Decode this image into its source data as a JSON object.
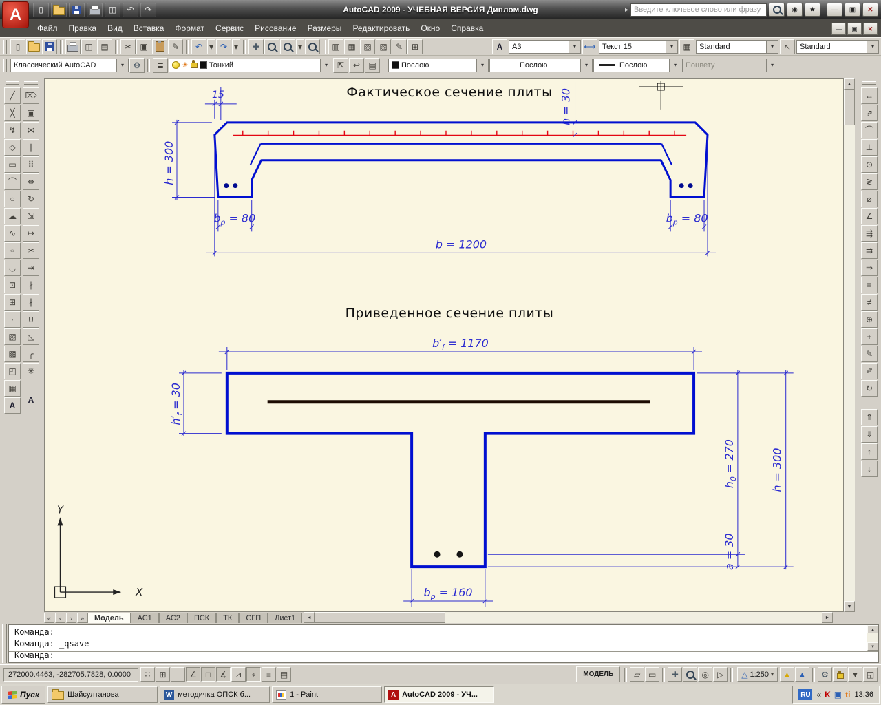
{
  "titlebar": {
    "logo_letter": "A",
    "title": "AutoCAD 2009 - УЧЕБНАЯ ВЕРСИЯ Диплом.dwg",
    "search_placeholder": "Введите ключевое слово или фразу",
    "quick_access": [
      {
        "name": "qnew-button",
        "glyph": "▯",
        "gcls": "c-light"
      },
      {
        "name": "open-button",
        "cls": "i-folder"
      },
      {
        "name": "save-button",
        "cls": "i-floppy"
      },
      {
        "name": "plot-button",
        "cls": "i-printer"
      },
      {
        "name": "plot-preview-button",
        "glyph": "◫",
        "gcls": "c-light"
      },
      {
        "name": "undo-button",
        "glyph": "↶",
        "gcls": "c-light"
      },
      {
        "name": "redo-button",
        "glyph": "↷",
        "gcls": "c-light"
      }
    ],
    "infocenter": [
      {
        "name": "search-button",
        "cls": "i-zoomglass"
      },
      {
        "name": "communication-center-button",
        "glyph": "◉"
      },
      {
        "name": "favorites-button",
        "glyph": "★"
      }
    ],
    "window_buttons": [
      {
        "name": "minimize-button",
        "glyph": "—"
      },
      {
        "name": "maximize-button",
        "glyph": "▣"
      },
      {
        "name": "close-button",
        "glyph": "✕",
        "cls2": "close"
      }
    ]
  },
  "menubar": {
    "items": [
      "Файл",
      "Правка",
      "Вид",
      "Вставка",
      "Формат",
      "Сервис",
      "Рисование",
      "Размеры",
      "Редактировать",
      "Окно",
      "Справка"
    ],
    "mdi_buttons": [
      {
        "name": "doc-minimize-button",
        "glyph": "—"
      },
      {
        "name": "doc-restore-button",
        "glyph": "▣"
      },
      {
        "name": "doc-close-button",
        "glyph": "✕",
        "cls2": "close"
      }
    ]
  },
  "toolbar1": {
    "items": [
      {
        "name": "qnew-button",
        "glyph": "▯"
      },
      {
        "name": "open-button",
        "cls": "i-folder"
      },
      {
        "name": "qsave-button",
        "cls": "i-floppy"
      },
      {
        "sep": true
      },
      {
        "name": "plot-button",
        "cls": "i-printer"
      },
      {
        "name": "plot-preview-button",
        "glyph": "◫"
      },
      {
        "name": "publish-button",
        "glyph": "▤"
      },
      {
        "sep": true
      },
      {
        "name": "cut-button",
        "glyph": "✂"
      },
      {
        "name": "copy-clip-button",
        "glyph": "▣"
      },
      {
        "name": "paste-button",
        "cls": "i-clipboard"
      },
      {
        "name": "match-properties-button",
        "glyph": "✎"
      },
      {
        "sep": true
      },
      {
        "name": "undo-button",
        "glyph": "↶",
        "gcls": "c-blue"
      },
      {
        "name": "undo-flyout-icon",
        "glyph": "▾",
        "cls2": "narrow"
      },
      {
        "name": "redo-button",
        "glyph": "↷",
        "gcls": "c-blue"
      },
      {
        "name": "redo-flyout-icon",
        "glyph": "▾",
        "cls2": "narrow"
      },
      {
        "sep": true
      },
      {
        "name": "pan-realtime-button",
        "glyph": "✚",
        "gcls": "c-dim"
      },
      {
        "name": "zoom-realtime-button",
        "cls": "i-zoomglass"
      },
      {
        "name": "zoom-window-button",
        "cls": "i-zoomglass"
      },
      {
        "name": "zoom-flyout-icon",
        "glyph": "▾",
        "cls2": "narrow"
      },
      {
        "name": "zoom-previous-button",
        "cls": "i-zoomglass"
      },
      {
        "sep": true
      },
      {
        "name": "properties-button",
        "glyph": "▥"
      },
      {
        "name": "design-center-button",
        "glyph": "▦"
      },
      {
        "name": "tool-palettes-button",
        "glyph": "▧"
      },
      {
        "name": "sheet-set-manager-button",
        "glyph": "▨"
      },
      {
        "name": "markup-set-manager-button",
        "glyph": "✎"
      },
      {
        "name": "quick-calc-button",
        "glyph": "⊞"
      }
    ],
    "icons": {
      "text_style": "A",
      "dim_style": "⟷",
      "table_style": "▦",
      "mleader_style": "↖"
    },
    "text_style": "А3",
    "dim_style": "Текст 15",
    "table_style": "Standard",
    "multileader_style": "Standard"
  },
  "toolbar2": {
    "workspace": "Классический AutoCAD",
    "pre": [
      {
        "name": "workspace-settings-button",
        "glyph": "⚙",
        "gcls": "c-dim"
      },
      {
        "sep": true
      },
      {
        "name": "layer-properties-manager-button",
        "glyph": "≣"
      }
    ],
    "layer": "Тонкий",
    "post": [
      {
        "name": "make-objects-layer-current-button",
        "glyph": "⇱"
      },
      {
        "name": "layer-previous-button",
        "glyph": "↩"
      },
      {
        "name": "layer-states-manager-button",
        "glyph": "▤"
      },
      {
        "sep": true
      }
    ],
    "color": "Послою",
    "linetype": "Послою",
    "lineweight": "Послою",
    "plot_style": "Поцвету"
  },
  "left_tools": {
    "draw": [
      {
        "name": "line-button",
        "glyph": "╱"
      },
      {
        "name": "construction-line-button",
        "glyph": "╳"
      },
      {
        "name": "polyline-button",
        "glyph": "↯"
      },
      {
        "name": "polygon-button",
        "glyph": "◇"
      },
      {
        "name": "rectangle-button",
        "glyph": "▭"
      },
      {
        "name": "arc-button",
        "glyph": "⌒"
      },
      {
        "name": "circle-button",
        "glyph": "○"
      },
      {
        "name": "revision-cloud-button",
        "glyph": "☁"
      },
      {
        "name": "spline-button",
        "glyph": "∿"
      },
      {
        "name": "ellipse-button",
        "glyph": "○",
        "gcls": "squash"
      },
      {
        "name": "ellipse-arc-button",
        "glyph": "◡"
      },
      {
        "name": "insert-block-button",
        "glyph": "⊡"
      },
      {
        "name": "make-block-button",
        "glyph": "⊞"
      },
      {
        "name": "point-button",
        "glyph": "∙"
      },
      {
        "name": "hatch-button",
        "glyph": "▨"
      },
      {
        "name": "gradient-button",
        "glyph": "▩"
      },
      {
        "name": "region-button",
        "glyph": "◰"
      },
      {
        "name": "table-button",
        "glyph": "▦"
      },
      {
        "name": "multiline-text-button",
        "glyph": "A",
        "gcls": "bA"
      }
    ],
    "modify": [
      {
        "name": "erase-button",
        "glyph": "⌦"
      },
      {
        "name": "copy-button",
        "glyph": "▣"
      },
      {
        "name": "mirror-button",
        "glyph": "⋈"
      },
      {
        "name": "offset-button",
        "glyph": "∥"
      },
      {
        "name": "array-button",
        "glyph": "⠿"
      },
      {
        "name": "move-button",
        "glyph": "⇹"
      },
      {
        "name": "rotate-button",
        "glyph": "↻"
      },
      {
        "name": "scale-button",
        "glyph": "⇲"
      },
      {
        "name": "stretch-button",
        "glyph": "↦"
      },
      {
        "name": "trim-button",
        "glyph": "✂"
      },
      {
        "name": "extend-button",
        "glyph": "⇥"
      },
      {
        "name": "break-at-point-button",
        "glyph": "∤"
      },
      {
        "name": "break-button",
        "glyph": "∦"
      },
      {
        "name": "join-button",
        "glyph": "∪"
      },
      {
        "name": "chamfer-button",
        "glyph": "◺"
      },
      {
        "name": "fillet-button",
        "glyph": "╭"
      },
      {
        "name": "explode-button",
        "glyph": "✳"
      },
      {
        "gap": true
      },
      {
        "name": "text-button",
        "glyph": "A",
        "gcls": "bA"
      }
    ]
  },
  "right_tools": {
    "items": [
      {
        "name": "dim-linear-button",
        "glyph": "↔"
      },
      {
        "name": "dim-aligned-button",
        "glyph": "⇗"
      },
      {
        "name": "dim-arc-length-button",
        "glyph": "⌒"
      },
      {
        "name": "dim-ordinate-button",
        "glyph": "⊥"
      },
      {
        "name": "dim-radius-button",
        "glyph": "⊙"
      },
      {
        "name": "dim-jogged-button",
        "glyph": "≷"
      },
      {
        "name": "dim-diameter-button",
        "glyph": "⌀"
      },
      {
        "name": "dim-angular-button",
        "glyph": "∠"
      },
      {
        "name": "quick-dimension-button",
        "glyph": "⇶"
      },
      {
        "name": "dim-baseline-button",
        "glyph": "⇉"
      },
      {
        "name": "dim-continue-button",
        "glyph": "⇒"
      },
      {
        "name": "dim-space-button",
        "glyph": "≡"
      },
      {
        "name": "dim-break-button",
        "glyph": "≠"
      },
      {
        "name": "tolerance-button",
        "glyph": "⊕"
      },
      {
        "name": "center-mark-button",
        "glyph": "+"
      },
      {
        "name": "dim-edit-button",
        "glyph": "✎"
      },
      {
        "name": "dim-text-edit-button",
        "glyph": "✎",
        "gcls": "flip"
      },
      {
        "name": "dim-update-button",
        "glyph": "↻"
      },
      {
        "gap": true
      },
      {
        "name": "bring-to-front-button",
        "glyph": "⇑"
      },
      {
        "name": "send-to-back-button",
        "glyph": "⇓"
      },
      {
        "name": "bring-above-objects-button",
        "glyph": "↑"
      },
      {
        "name": "send-under-objects-button",
        "glyph": "↓"
      }
    ]
  },
  "canvas": {
    "top": {
      "title": "Фактическое сечение плиты",
      "dims": {
        "d15": [
          {
            "t": "15"
          }
        ],
        "h300": [
          {
            "t": "h = 300"
          }
        ],
        "hf30": [
          {
            "t": "h = 30"
          }
        ],
        "bp80l": [
          {
            "t": "b"
          },
          {
            "t": "p",
            "sub": true
          },
          {
            "t": " = 80"
          }
        ],
        "bp80r": [
          {
            "t": "b"
          },
          {
            "t": "p",
            "sub": true
          },
          {
            "t": " = 80"
          }
        ],
        "b1200": [
          {
            "t": "b = 1200"
          }
        ]
      }
    },
    "bottom": {
      "title": "Приведенное сечение плиты",
      "dims": {
        "bf1170": [
          {
            "t": "b′"
          },
          {
            "t": "f",
            "sub": true
          },
          {
            "t": " = 1170"
          }
        ],
        "hf30": [
          {
            "t": "h′"
          },
          {
            "t": "f",
            "sub": true
          },
          {
            "t": " = 30"
          }
        ],
        "h0270": [
          {
            "t": "h"
          },
          {
            "t": "0",
            "sub": true
          },
          {
            "t": " = 270"
          }
        ],
        "h300": [
          {
            "t": "h = 300"
          }
        ],
        "a30": [
          {
            "t": "a = 30"
          }
        ],
        "bp160": [
          {
            "t": "b"
          },
          {
            "t": "p",
            "sub": true
          },
          {
            "t": " = 160"
          }
        ]
      }
    },
    "ucs": {
      "x_label": "X",
      "y_label": "Y"
    }
  },
  "tabs": {
    "nav": [
      {
        "name": "tab-first-button",
        "glyph": "«"
      },
      {
        "name": "tab-prev-button",
        "glyph": "‹"
      },
      {
        "name": "tab-next-button",
        "glyph": "›"
      },
      {
        "name": "tab-last-button",
        "glyph": "»"
      }
    ],
    "items": [
      {
        "name": "tab-model",
        "label": "Модель",
        "cls2": "active"
      },
      {
        "name": "tab-as1",
        "label": "АС1"
      },
      {
        "name": "tab-as2",
        "label": "АС2"
      },
      {
        "name": "tab-psk",
        "label": "ПСК"
      },
      {
        "name": "tab-tk",
        "label": "ТК"
      },
      {
        "name": "tab-sgp",
        "label": "СГП"
      },
      {
        "name": "tab-list1",
        "label": "Лист1"
      }
    ]
  },
  "command": {
    "history": [
      "Команда:",
      "Команда: _qsave"
    ],
    "prompt": "Команда:"
  },
  "statusbar": {
    "coords": "272000.4463, -282705.7828, 0.0000",
    "toggles": [
      {
        "name": "snap-toggle",
        "glyph": "∷"
      },
      {
        "name": "grid-toggle",
        "glyph": "⊞"
      },
      {
        "name": "ortho-toggle",
        "glyph": "∟"
      },
      {
        "name": "polar-toggle",
        "glyph": "∠",
        "pressed": true
      },
      {
        "name": "osnap-toggle",
        "glyph": "□",
        "pressed": true
      },
      {
        "name": "otrack-toggle",
        "glyph": "∡",
        "pressed": true
      },
      {
        "name": "ducs-toggle",
        "glyph": "⊿"
      },
      {
        "name": "dyn-toggle",
        "glyph": "⌖",
        "pressed": true
      },
      {
        "name": "lwt-toggle",
        "glyph": "≡"
      },
      {
        "name": "qp-toggle",
        "glyph": "▤"
      }
    ],
    "model_label": "МОДЕЛЬ",
    "right_items": [
      {
        "sep": true
      },
      {
        "name": "quick-view-layouts-button",
        "glyph": "▱"
      },
      {
        "name": "quick-view-drawings-button",
        "glyph": "▭"
      },
      {
        "sep": true
      },
      {
        "name": "pan-realtime-button",
        "glyph": "✚",
        "gcls": "c-dim"
      },
      {
        "name": "zoom-realtime-button",
        "cls": "i-zoomglass"
      },
      {
        "name": "steering-wheel-button",
        "glyph": "◎"
      },
      {
        "name": "show-motion-button",
        "glyph": "▷"
      },
      {
        "sep": true
      }
    ],
    "scale": "1:250",
    "right_items2": [
      {
        "name": "annotation-visibility-button",
        "glyph": "▲",
        "gcls": "c-yellow"
      },
      {
        "name": "annotation-autoscale-button",
        "glyph": "▲",
        "gcls": "c-blue"
      },
      {
        "sep": true
      },
      {
        "name": "workspace-switching-button",
        "glyph": "⚙",
        "gcls": "c-dim"
      },
      {
        "name": "toolbar-lock-button",
        "cls": "i-lock"
      },
      {
        "name": "status-bar-menu-button",
        "glyph": "▾"
      },
      {
        "name": "clean-screen-button",
        "glyph": "◱"
      }
    ]
  },
  "taskbar": {
    "start_label": "Пуск",
    "items": [
      {
        "name": "taskbar-item-explorer",
        "cls": "ic-folder",
        "label": "Шайсултанова"
      },
      {
        "name": "taskbar-item-word",
        "cls": "ic-word",
        "label": "методичка ОПСК б..."
      },
      {
        "name": "taskbar-item-paint",
        "cls": "ic-paint",
        "label": "1 - Paint"
      },
      {
        "name": "taskbar-item-autocad",
        "cls": "ic-acad",
        "label": "AutoCAD 2009 - УЧ...",
        "cls2": "active"
      }
    ],
    "language": "RU",
    "tray": [
      {
        "name": "tray-chevron-icon",
        "glyph": "«"
      },
      {
        "name": "kaspersky-tray-icon",
        "glyph": "K",
        "gcls": "c-red bold"
      },
      {
        "name": "tray-app-icon",
        "glyph": "▣",
        "gcls": "c-blue"
      },
      {
        "name": "traffic-inspector-tray-icon",
        "glyph": "ti",
        "gcls": "c-orange bold"
      }
    ],
    "clock": "13:36"
  }
}
